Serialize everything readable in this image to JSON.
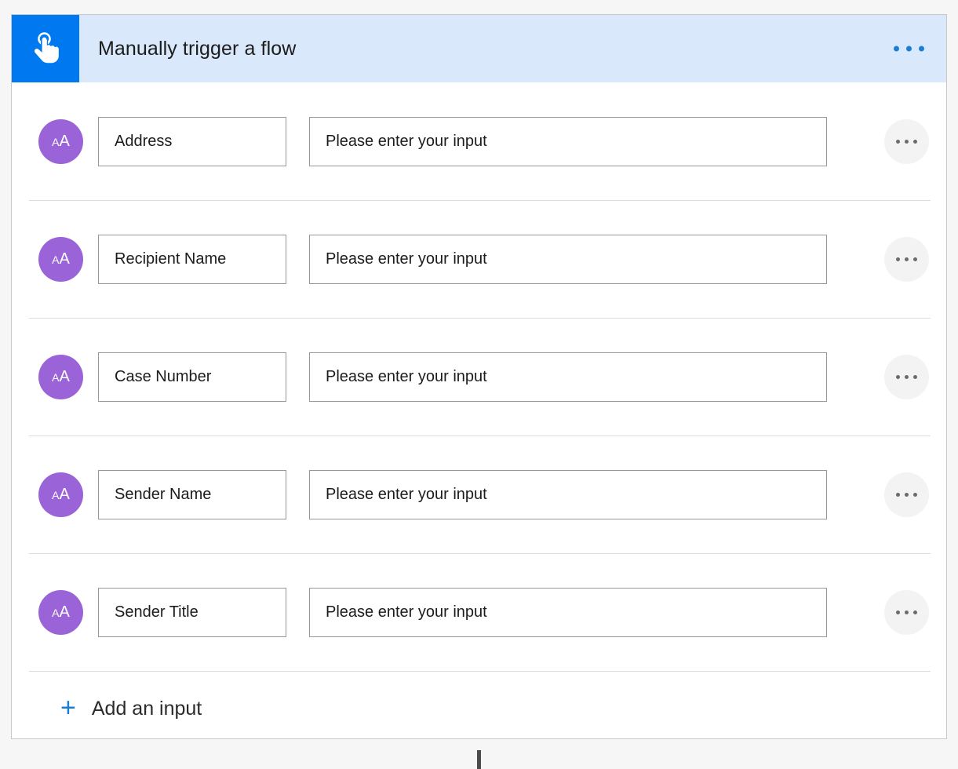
{
  "card": {
    "header": {
      "icon": "tap-hand-icon",
      "icon_bg": "#0078f0",
      "background": "#d9e9fb",
      "title": "Manually trigger a flow",
      "menu_icon": "ellipsis-icon",
      "menu_dot_color": "#1a7fd4"
    },
    "avatar": {
      "icon": "text-type-icon",
      "glyph_small": "A",
      "glyph_big": "A",
      "background": "#9a63d8"
    },
    "row_menu": {
      "icon": "ellipsis-icon",
      "dot_color": "#6b6b6b",
      "background": "#f3f3f3"
    },
    "inputs": [
      {
        "name": "Address",
        "value": "",
        "placeholder": "Please enter your input"
      },
      {
        "name": "Recipient Name",
        "value": "",
        "placeholder": "Please enter your input"
      },
      {
        "name": "Case Number",
        "value": "",
        "placeholder": "Please enter your input"
      },
      {
        "name": "Sender Name",
        "value": "",
        "placeholder": "Please enter your input"
      },
      {
        "name": "Sender Title",
        "value": "",
        "placeholder": "Please enter your input"
      }
    ],
    "add_input": {
      "icon": "plus-icon",
      "label": "Add an input",
      "accent": "#1a7fd4"
    }
  },
  "connector": {
    "color": "#4b4b4b"
  }
}
